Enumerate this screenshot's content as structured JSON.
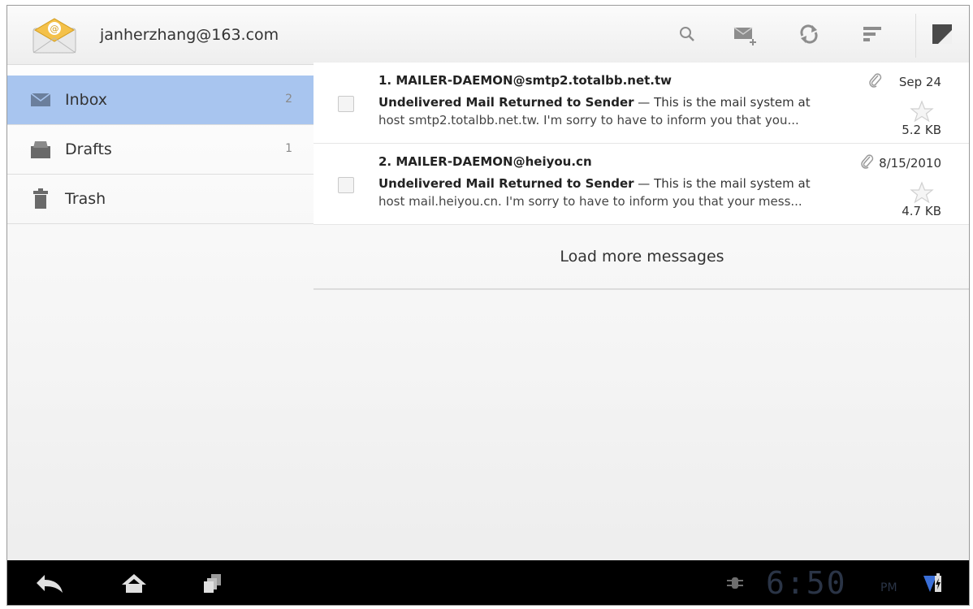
{
  "account": {
    "email": "janherzhang@163.com"
  },
  "toolbar": {
    "search_icon": "search-icon",
    "compose_icon": "compose-icon",
    "refresh_icon": "refresh-icon",
    "sort_icon": "sort-icon",
    "menu_icon": "overflow-menu-icon"
  },
  "folders": [
    {
      "label": "Inbox",
      "count": "2",
      "icon": "inbox-icon",
      "selected": true
    },
    {
      "label": "Drafts",
      "count": "1",
      "icon": "drafts-icon",
      "selected": false
    },
    {
      "label": "Trash",
      "count": "",
      "icon": "trash-icon",
      "selected": false
    }
  ],
  "messages": [
    {
      "from": "1. MAILER-DAEMON@smtp2.totalbb.net.tw",
      "subject": "Undelivered Mail Returned to Sender",
      "snippet1": " — This is the mail system at",
      "snippet2": "host smtp2.totalbb.net.tw. I'm sorry to have to inform you that you...",
      "date": "Sep 24",
      "size": "5.2 KB"
    },
    {
      "from": "2. MAILER-DAEMON@heiyou.cn",
      "subject": "Undelivered Mail Returned to Sender",
      "snippet1": " — This is the mail system at",
      "snippet2": "host mail.heiyou.cn. I'm sorry to have to inform you that your mess...",
      "date": "8/15/2010",
      "size": "4.7 KB"
    }
  ],
  "load_more": "Load more messages",
  "system_bar": {
    "time": "6:50",
    "ampm": "PM",
    "accent_color": "#3a6fd8"
  },
  "colors": {
    "selected_folder": "#a8c5ef",
    "system_bar": "#000000"
  }
}
